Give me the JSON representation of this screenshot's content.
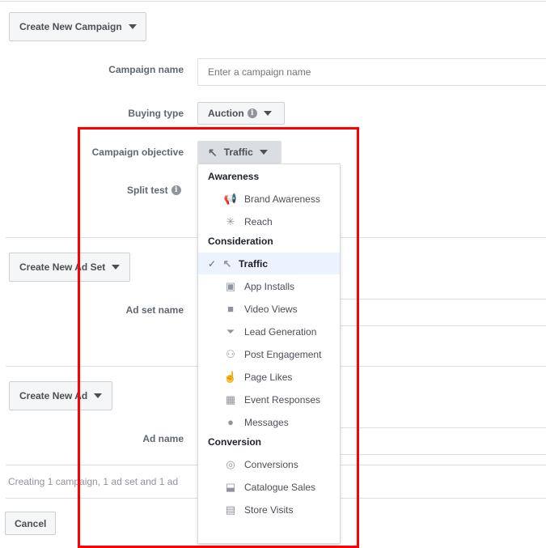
{
  "campaign": {
    "create_button": "Create New Campaign",
    "name_label": "Campaign name",
    "name_placeholder": "Enter a campaign name",
    "buying_type_label": "Buying type",
    "buying_type_value": "Auction",
    "objective_label": "Campaign objective",
    "objective_value": "Traffic",
    "split_test_label": "Split test"
  },
  "adset": {
    "create_button": "Create New Ad Set",
    "name_label": "Ad set name"
  },
  "ad": {
    "create_button": "Create New Ad",
    "name_label": "Ad name"
  },
  "summary": "Creating 1 campaign, 1 ad set and 1 ad",
  "cancel_button": "Cancel",
  "highlight_color": "#ff0000",
  "objective_menu": {
    "groups": [
      {
        "header": "Awareness",
        "items": [
          {
            "label": "Brand Awareness",
            "icon": "megaphone-icon"
          },
          {
            "label": "Reach",
            "icon": "reach-icon"
          }
        ]
      },
      {
        "header": "Consideration",
        "items": [
          {
            "label": "Traffic",
            "icon": "cursor-icon",
            "selected": true
          },
          {
            "label": "App Installs",
            "icon": "box-icon"
          },
          {
            "label": "Video Views",
            "icon": "video-camera-icon"
          },
          {
            "label": "Lead Generation",
            "icon": "funnel-icon"
          },
          {
            "label": "Post Engagement",
            "icon": "people-icon"
          },
          {
            "label": "Page Likes",
            "icon": "thumbs-up-icon"
          },
          {
            "label": "Event Responses",
            "icon": "calendar-icon"
          },
          {
            "label": "Messages",
            "icon": "chat-bubbles-icon"
          }
        ]
      },
      {
        "header": "Conversion",
        "items": [
          {
            "label": "Conversions",
            "icon": "globe-icon"
          },
          {
            "label": "Catalogue Sales",
            "icon": "cart-icon"
          },
          {
            "label": "Store Visits",
            "icon": "store-icon"
          }
        ]
      }
    ]
  }
}
